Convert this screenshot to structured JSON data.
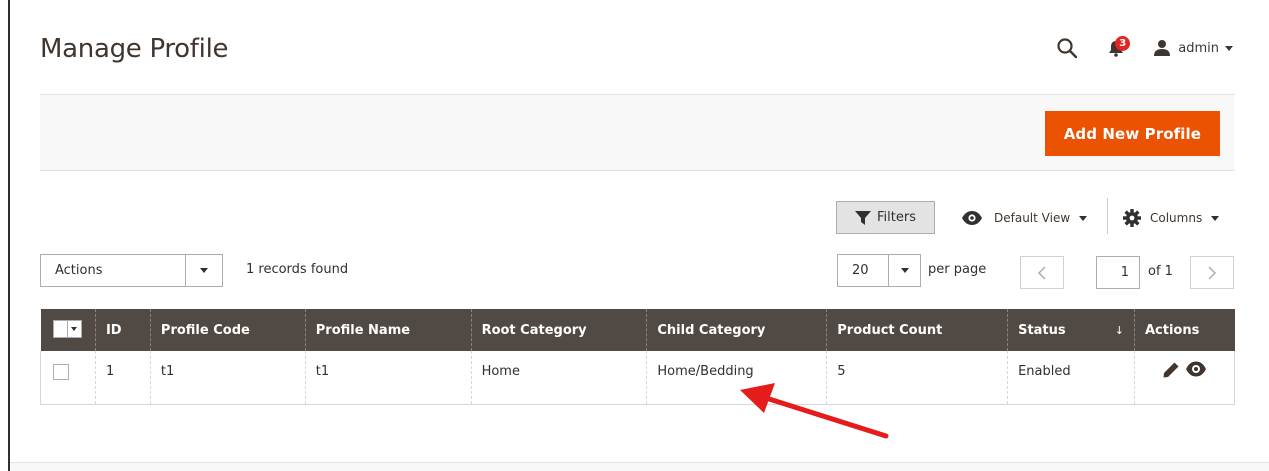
{
  "header": {
    "title": "Manage Profile",
    "notification_count": "3",
    "user": "admin"
  },
  "toolbar": {
    "add_button": "Add New Profile"
  },
  "grid_controls": {
    "filters": "Filters",
    "view": "Default View",
    "columns": "Columns",
    "actions_select": "Actions",
    "records_found": "1 records found",
    "per_page_value": "20",
    "per_page_label": "per page",
    "current_page": "1",
    "of_pages": "of 1"
  },
  "table": {
    "columns": [
      "ID",
      "Profile Code",
      "Profile Name",
      "Root Category",
      "Child Category",
      "Product Count",
      "Status",
      "Actions"
    ],
    "rows": [
      {
        "id": "1",
        "profile_code": "t1",
        "profile_name": "t1",
        "root_category": "Home",
        "child_category": "Home/Bedding",
        "product_count": "5",
        "status": "Enabled"
      }
    ]
  },
  "colors": {
    "accent": "#eb5202",
    "table_header": "#514943",
    "badge": "#e22626",
    "annotation": "#e51c1c"
  },
  "icons": {
    "search": "search-icon",
    "notifications": "bell-icon",
    "user": "user-icon",
    "filter": "filter-icon",
    "view": "eye-icon",
    "columns": "gear-icon",
    "edit": "pencil-icon",
    "preview": "eye-icon"
  }
}
